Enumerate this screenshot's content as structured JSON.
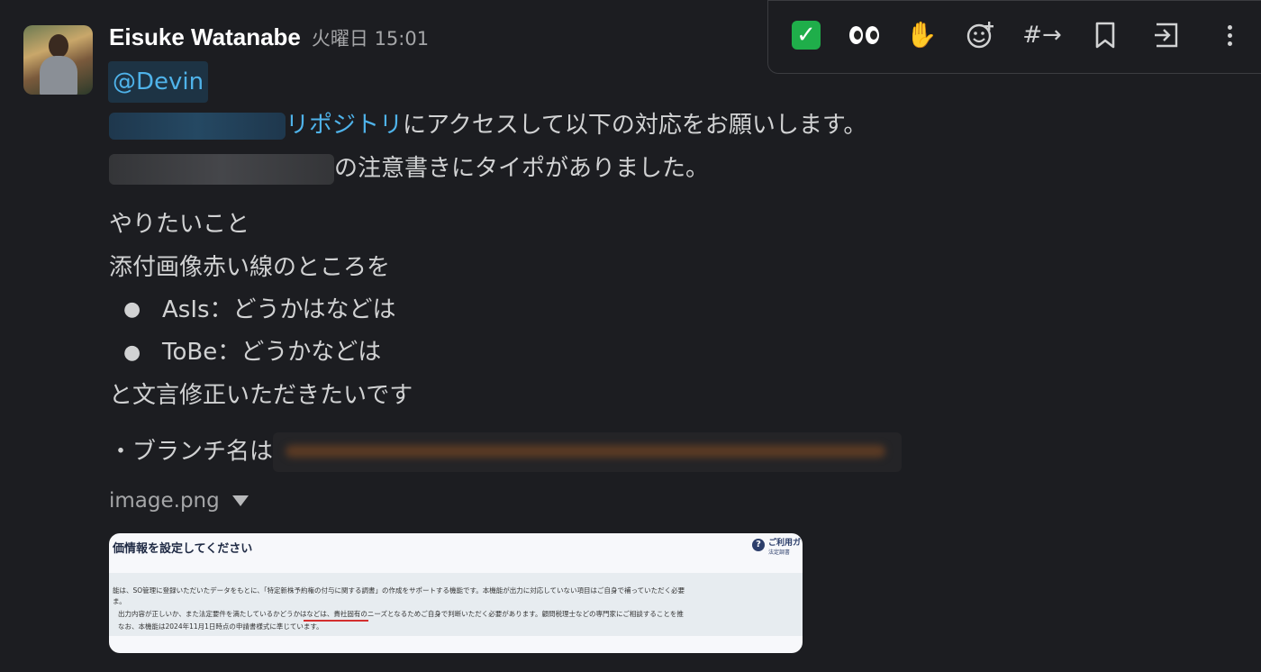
{
  "message": {
    "author": "Eisuke Watanabe",
    "timestamp": "火曜日 15:01",
    "mention": "@Devin",
    "line1_link": "リポジトリ",
    "line1_rest": "にアクセスして以下の対応をお願いします。",
    "line2_rest": "の注意書きにタイポがありました。",
    "heading": "やりたいこと",
    "line3": "添付画像赤い線のところを",
    "bullets": [
      "AsIs：どうかはなどは",
      "ToBe：どうかなどは"
    ],
    "line4": "と文言修正いただきたいです",
    "branch_label": "・ブランチ名は"
  },
  "attachment": {
    "file_name": "image.png",
    "preview": {
      "title": "価情報を設定してください",
      "help_title": "ご利用ガ",
      "help_sub": "法定調書",
      "text1": "能は、SO管理に登録いただいたデータをもとに、「特定新株予約権の付与に関する調書」の作成をサポートする機能です。本機能が出力に対応していない項目はご自身で補っていただく必要",
      "text2": "ま。",
      "text3": "出力内容が正しいか、また法定要件を満たしているかどうかはなどは、貴社固有のニーズとなるためご自身で判断いただく必要があります。顧問税理士などの専門家にご相談することを推",
      "text4": "なお、本機能は2024年11月1日時点の申請書様式に準じています。"
    }
  },
  "toolbar": {
    "icons": [
      "white-check-mark",
      "eyes",
      "raised-hands",
      "add-reaction",
      "reply-in-thread",
      "bookmark",
      "forward",
      "more-actions"
    ]
  },
  "colors": {
    "background": "#1c1d21",
    "link": "#4fb3ea",
    "mention_bg": "#1d3344",
    "check_green": "#1fae4a",
    "underline_red": "#d32f2f"
  }
}
